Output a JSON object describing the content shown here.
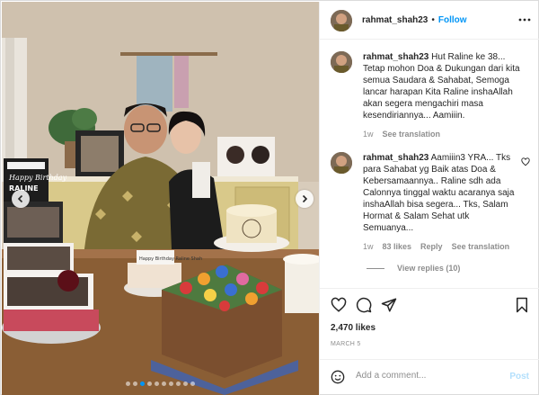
{
  "post": {
    "username": "rahmat_shah23",
    "separator": "•",
    "follow_label": "Follow",
    "more_icon": "more-horizontal-icon"
  },
  "photo": {
    "cake_label_1": "Happy Birthday",
    "cake_label_2": "RALINE",
    "cake_card": "Happy Birthday Raline Shah",
    "prev_icon": "chevron-left-icon",
    "next_icon": "chevron-right-icon",
    "carousel_count": 10,
    "carousel_active": 3
  },
  "comments": [
    {
      "username": "rahmat_shah23",
      "text": "Hut Raline ke 38... Tetap mohon Doa & Dukungan dari kita semua Saudara & Sahabat, Semoga lancar harapan Kita Raline inshaAllah akan segera mengachiri masa kesendiriannya... Aamiiin.",
      "time": "1w",
      "see_translation": "See translation"
    },
    {
      "username": "rahmat_shah23",
      "text": "Aamiiin3 YRA... Tks para Sahabat yg Baik atas Doa & Kebersamaannya.. Raline sdh ada Calonnya tinggal waktu acaranya saja inshaAllah bisa segera... Tks, Salam Hormat & Salam Sehat utk Semuanya...",
      "time": "1w",
      "likes": "83 likes",
      "reply": "Reply",
      "see_translation": "See translation",
      "view_replies": "View replies (10)"
    }
  ],
  "actions": {
    "like_icon": "heart-icon",
    "comment_icon": "comment-icon",
    "share_icon": "send-icon",
    "save_icon": "bookmark-icon"
  },
  "likes_text": "2,470 likes",
  "date_text": "MARCH 5",
  "add_comment": {
    "emoji_icon": "smiley-icon",
    "placeholder": "Add a comment...",
    "post_label": "Post"
  },
  "colors": {
    "link_blue": "#0095f6",
    "post_disabled": "#b2dffc",
    "muted_text": "#8e8e8e",
    "border": "#efefef"
  }
}
